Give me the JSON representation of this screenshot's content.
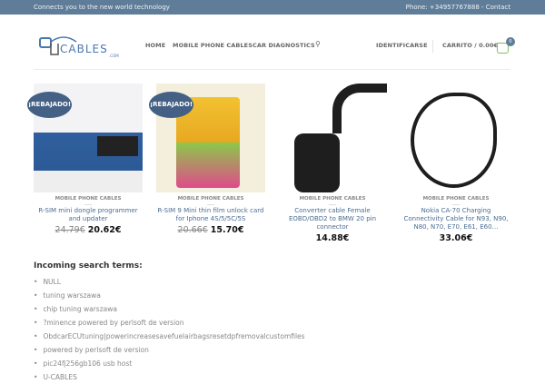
{
  "topbar": {
    "tagline": "Connects you to the new world technology",
    "contact": "Phone: +34957767888 - Contact"
  },
  "header": {
    "logo_text": "UCABLES",
    "logo_sub": ".COM",
    "nav": [
      "HOME",
      "MOBILE PHONE CABLES",
      "CAR DIAGNOSTICS"
    ],
    "login": "IDENTIFICARSE",
    "cart": "CARRITO / 0.00€",
    "cart_count": "0"
  },
  "products": [
    {
      "badge": "¡REBAJADO!",
      "category": "MOBILE PHONE CABLES",
      "title": "R-SIM mini dongle programmer and updater",
      "old_price": "24.79€",
      "price": "20.62€"
    },
    {
      "badge": "¡REBAJADO!",
      "category": "MOBILE PHONE CABLES",
      "title": "R-SIM 9 Mini thin film unlock card for Iphone 4S/5/5C/5S",
      "old_price": "20.66€",
      "price": "15.70€"
    },
    {
      "category": "MOBILE PHONE CABLES",
      "title": "Converter cable Female EOBD/OBD2 to BMW 20 pin connector",
      "price": "14.88€"
    },
    {
      "category": "MOBILE PHONE CABLES",
      "title": "Nokia CA-70 Charging Connectivity Cable for N93, N90, N80, N70, E70, E61, E60…",
      "price": "33.06€"
    }
  ],
  "search_terms": {
    "heading": "Incoming search terms:",
    "items": [
      "NULL",
      "tuning warszawa",
      "chip tuning warszawa",
      "?minence powered by perlsoft de version",
      "ObdcarECUtuning|powerincreasesavefuelairbagsresetdpfremovalcustomfiles",
      "powered by perlsoft de version",
      "pic24fj256gb106 usb host",
      "U-CABLES"
    ]
  }
}
